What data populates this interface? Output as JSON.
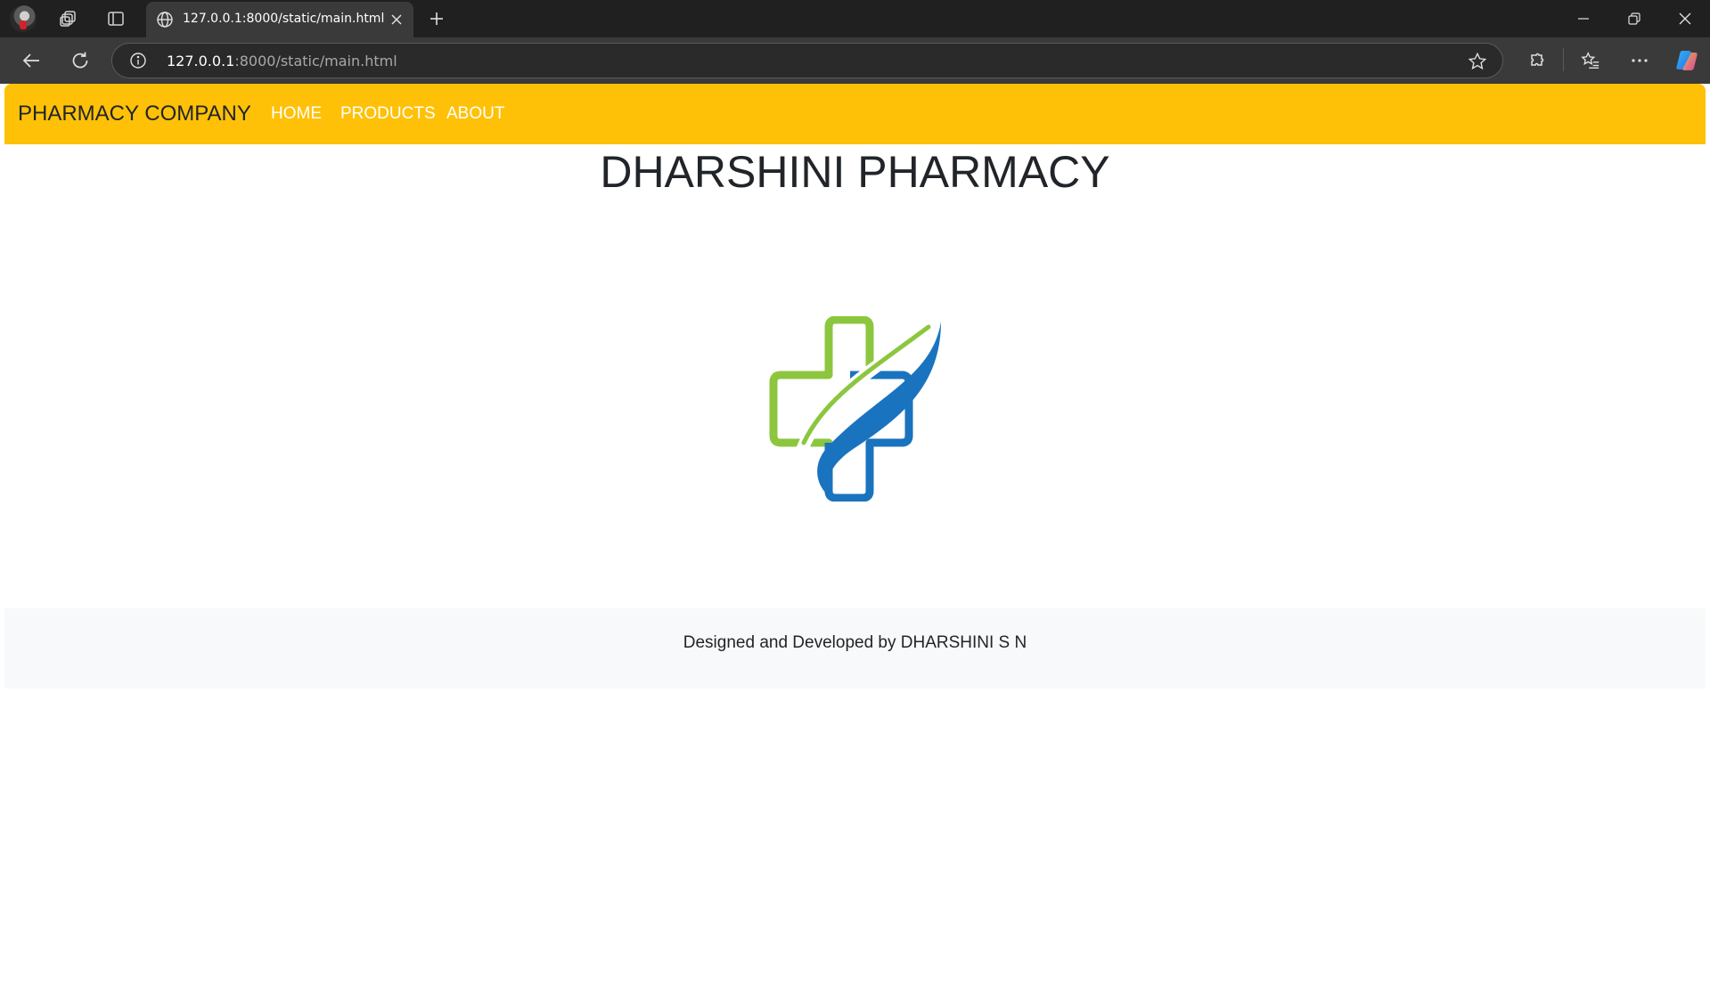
{
  "browser": {
    "tab": {
      "title": "127.0.0.1:8000/static/main.html"
    },
    "address": {
      "host": "127.0.0.1",
      "rest": ":8000/static/main.html"
    }
  },
  "icons": [
    "profile-avatar",
    "workspaces-icon",
    "vertical-tabs-icon",
    "globe-icon",
    "close-icon",
    "plus-icon",
    "minimize-icon",
    "restore-icon",
    "window-close-icon",
    "back-arrow-icon",
    "refresh-icon",
    "info-icon",
    "star-icon",
    "extensions-icon",
    "favorites-icon",
    "more-icon",
    "copilot-icon"
  ],
  "page": {
    "navbar": {
      "brand": "PHARMACY COMPANY",
      "links": [
        "HOME",
        "PRODUCTS",
        "ABOUT"
      ]
    },
    "title": "DHARSHINI PHARMACY",
    "footer": "Designed and Developed by DHARSHINI S N"
  },
  "colors": {
    "navbar": "#ffc107",
    "logo_green": "#8cc63f",
    "logo_blue": "#1a73bf",
    "footer_bg": "#f8f9fa"
  }
}
